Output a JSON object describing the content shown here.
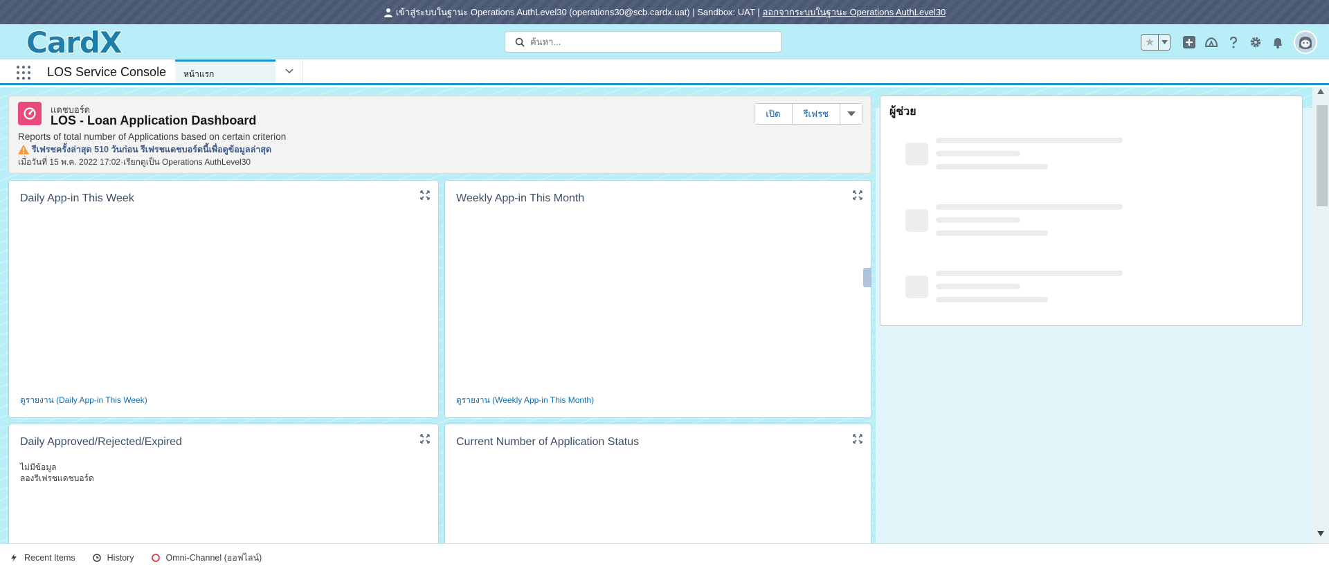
{
  "banner": {
    "text": "เข้าสู่ระบบในฐานะ Operations AuthLevel30 (operations30@scb.cardx.uat) | Sandbox: UAT |",
    "logout_link": "ออกจากระบบในฐานะ Operations AuthLevel30"
  },
  "header": {
    "logo_text": "CardX",
    "search_placeholder": "ค้นหา..."
  },
  "nav": {
    "app_name": "LOS Service Console",
    "tab_label": "หน้าแรก"
  },
  "dashboard": {
    "kicker": "แดชบอร์ด",
    "title": "LOS - Loan Application Dashboard",
    "description": "Reports of total number of Applications based on certain criterion",
    "warning": "รีเฟรชครั้งล่าสุด 510 วันก่อน รีเฟรชแดชบอร์ดนี้เพื่อดูข้อมูลล่าสุด",
    "as_of": "เมื่อวันที่ 15 พ.ค. 2022 17:02·เรียกดูเป็น Operations AuthLevel30",
    "buttons": {
      "open": "เปิด",
      "refresh": "รีเฟรช"
    }
  },
  "widgets": {
    "w1": {
      "title": "Daily App-in This Week",
      "link": "ดูรายงาน (Daily App-in This Week)"
    },
    "w2": {
      "title": "Weekly App-in This Month",
      "link": "ดูรายงาน (Weekly App-in This Month)"
    },
    "w3": {
      "title": "Daily Approved/Rejected/Expired",
      "empty1": "ไม่มีข้อมูล",
      "empty2": "ลองรีเฟรชแดชบอร์ด"
    },
    "w4": {
      "title": "Current Number of Application Status"
    }
  },
  "assistant": {
    "title": "ผู้ช่วย"
  },
  "utility_bar": {
    "recent": "Recent Items",
    "history": "History",
    "omni": "Omni-Channel (ออฟไลน์)"
  },
  "colors": {
    "banner": "#4a5874",
    "header": "#b8eef7",
    "accent": "#1b96c9",
    "dashboard_icon": "#e84a7a",
    "link": "#0b6fb5"
  }
}
